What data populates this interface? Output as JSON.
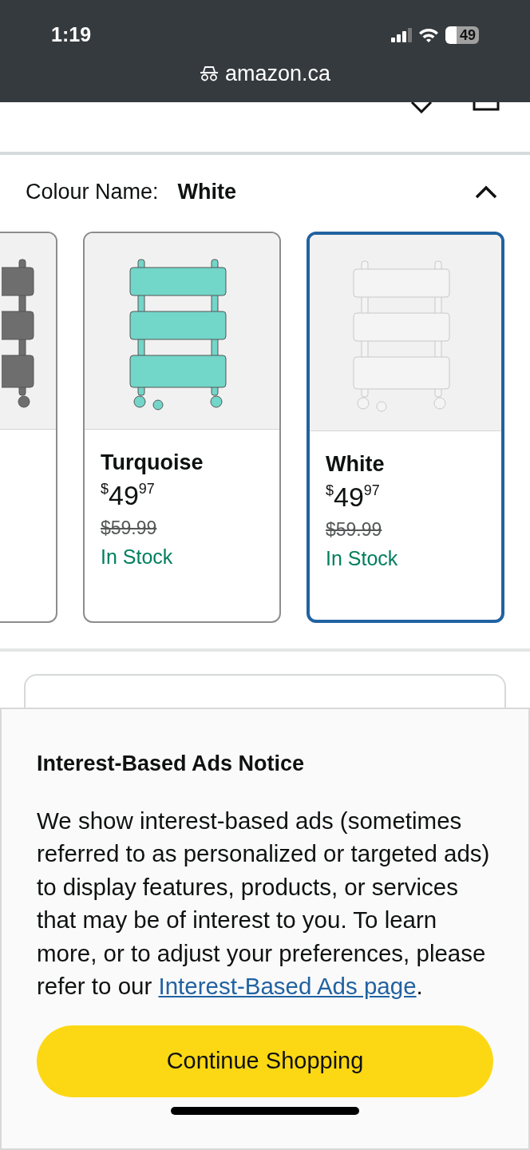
{
  "status_bar": {
    "time": "1:19",
    "battery": "49"
  },
  "address_bar": {
    "url": "amazon.ca"
  },
  "colour_selector": {
    "label": "Colour Name:",
    "value": "White",
    "expanded": true,
    "swatches": [
      {
        "selected": false,
        "color": "#6e6e6e"
      },
      {
        "name": "Turquoise",
        "price_symbol": "$",
        "price_whole": "49",
        "price_fraction": "97",
        "list_price": "$59.99",
        "availability": "In Stock",
        "selected": false,
        "color": "#72d6c9"
      },
      {
        "name": "White",
        "price_symbol": "$",
        "price_whole": "49",
        "price_fraction": "97",
        "list_price": "$59.99",
        "availability": "In Stock",
        "selected": true,
        "color": "#f4f4f4"
      }
    ]
  },
  "notice": {
    "title": "Interest-Based Ads Notice",
    "body": "We show interest-based ads (sometimes referred to as personalized or targeted ads) to display features, products, or services that may be of interest to you. To learn more, or to adjust your preferences, please refer to our",
    "link": "Interest-Based Ads page",
    "after_link": ".",
    "button": "Continue Shopping"
  }
}
